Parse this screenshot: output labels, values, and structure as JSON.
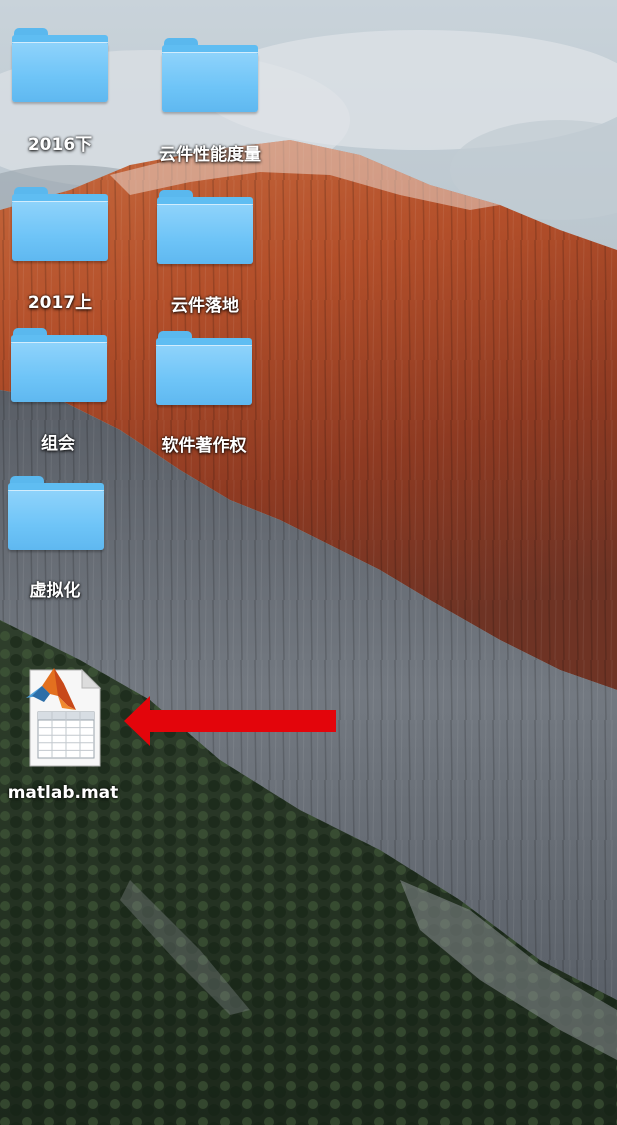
{
  "desktop": {
    "icons": [
      {
        "label": "2016下",
        "type": "folder",
        "icon": "folder-icon"
      },
      {
        "label": "云件性能度量",
        "type": "folder",
        "icon": "folder-icon"
      },
      {
        "label": "2017上",
        "type": "folder",
        "icon": "folder-icon"
      },
      {
        "label": "云件落地",
        "type": "folder",
        "icon": "folder-icon"
      },
      {
        "label": "组会",
        "type": "folder",
        "icon": "folder-icon"
      },
      {
        "label": "软件著作权",
        "type": "folder",
        "icon": "folder-icon"
      },
      {
        "label": "虚拟化",
        "type": "folder",
        "icon": "folder-icon"
      },
      {
        "label": "matlab.mat",
        "type": "file",
        "icon": "matlab-file-icon"
      }
    ],
    "annotation": {
      "icon": "red-arrow-icon",
      "color": "#e3050b"
    }
  },
  "colors": {
    "folder": "#6ec4f7",
    "arrow": "#e3050b"
  }
}
